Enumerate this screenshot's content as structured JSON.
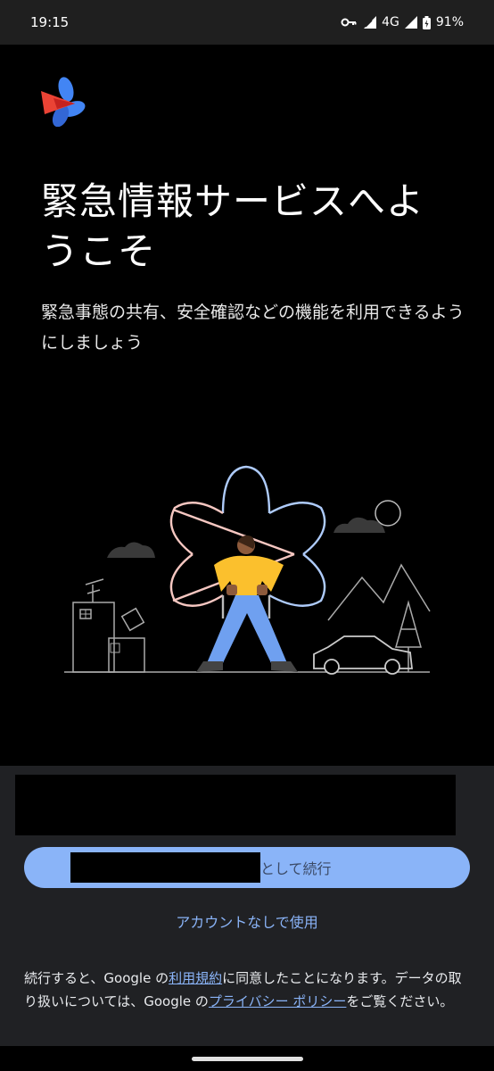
{
  "status_bar": {
    "time": "19:15",
    "network": "4G",
    "battery": "91%",
    "icons": [
      "vpn-key-icon",
      "wifi-icon",
      "signal-icon",
      "battery-icon"
    ]
  },
  "app": {
    "logo": "emergency-info-logo",
    "title": "緊急情報サービスへようこそ",
    "subtitle": "緊急事態の共有、安全確認などの機能を利用できるようにしましょう"
  },
  "illustration": "person-with-safety-symbol-city-mountains-car",
  "account": {
    "continue_suffix": "として続行",
    "no_account_link": "アカウントなしで使用"
  },
  "legal": {
    "part1": "続行すると、Google の",
    "terms_link": "利用規約",
    "part2": "に同意したことになります。データの取り扱いについては、Google の",
    "privacy_link": "プライバシー ポリシー",
    "part3": "をご覧ください。"
  },
  "colors": {
    "accent": "#8ab4f8",
    "sheet_bg": "#202124",
    "illustration_yellow": "#fbc02d",
    "illustration_blue": "#6fa0f0"
  }
}
